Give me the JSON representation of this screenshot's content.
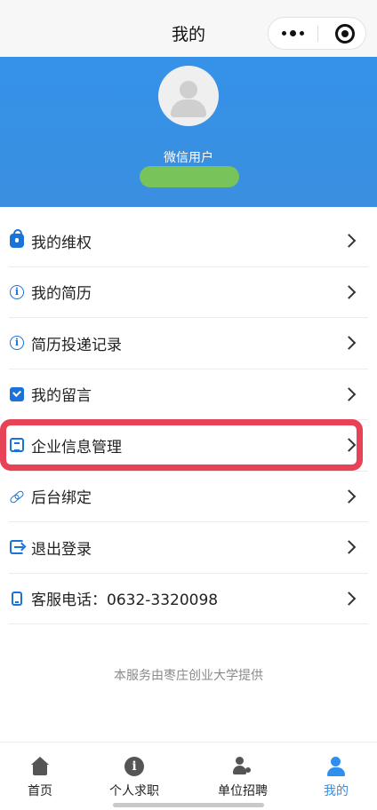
{
  "navbar": {
    "title": "我的"
  },
  "profile": {
    "username": "微信用户"
  },
  "menu": {
    "items": [
      {
        "label": "我的维权",
        "icon": "lock-icon"
      },
      {
        "label": "我的简历",
        "icon": "info-icon"
      },
      {
        "label": "简历投递记录",
        "icon": "info-icon"
      },
      {
        "label": "我的留言",
        "icon": "note-icon"
      },
      {
        "label": "企业信息管理",
        "icon": "document-icon",
        "highlighted": true
      },
      {
        "label": "后台绑定",
        "icon": "link-icon"
      },
      {
        "label": "退出登录",
        "icon": "logout-icon"
      },
      {
        "label": "客服电话：0632-3320098",
        "icon": "phone-icon"
      }
    ]
  },
  "footer": {
    "note": "本服务由枣庄创业大学提供"
  },
  "tabbar": {
    "tabs": [
      {
        "label": "首页",
        "icon": "home-icon"
      },
      {
        "label": "个人求职",
        "icon": "info-icon"
      },
      {
        "label": "单位招聘",
        "icon": "add-user-icon"
      },
      {
        "label": "我的",
        "icon": "user-icon",
        "active": true
      }
    ]
  },
  "colors": {
    "header_blue": "#3a8fe0",
    "accent_blue": "#2f8ff0",
    "icon_blue": "#1a73d9",
    "highlight_red": "#e84256",
    "redaction_green": "#79c35b"
  }
}
